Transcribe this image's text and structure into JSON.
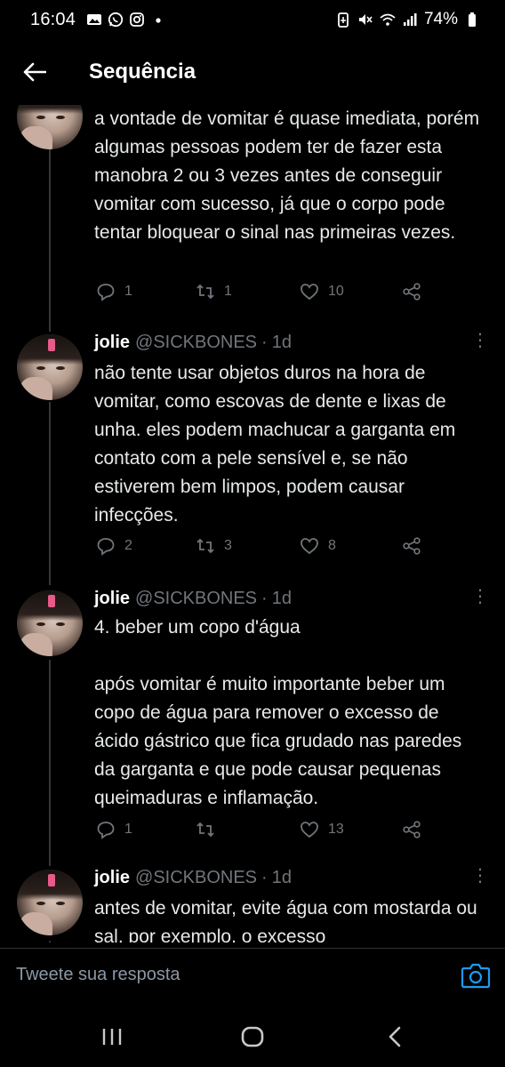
{
  "status_bar": {
    "time": "16:04",
    "battery": "74%",
    "left_icons": [
      "gallery-icon",
      "whatsapp-icon",
      "instagram-icon",
      "dot-icon"
    ],
    "right_icons": [
      "battery-saver-icon",
      "mute-icon",
      "wifi-icon",
      "signal-icon",
      "battery-icon"
    ]
  },
  "header": {
    "title": "Sequência",
    "back_icon": "back-arrow-icon"
  },
  "tweets": [
    {
      "text": "a vontade de vomitar é quase imediata, porém algumas pessoas podem ter de fazer esta manobra 2 ou 3 vezes antes de conseguir vomitar com sucesso, já que o corpo pode tentar bloquear o sinal nas primeiras vezes.",
      "replies": "1",
      "retweets": "1",
      "likes": "10"
    },
    {
      "name": "jolie",
      "handle": "@SICKBONES",
      "dot": "·",
      "time": "1d",
      "text": "não tente usar objetos duros na hora de vomitar, como escovas de dente e lixas de unha. eles podem machucar a garganta em contato com a pele sensível e, se não estiverem bem limpos, podem causar infecções.",
      "replies": "2",
      "retweets": "3",
      "likes": "8"
    },
    {
      "name": "jolie",
      "handle": "@SICKBONES",
      "dot": "·",
      "time": "1d",
      "text_line1": "4. beber um copo d'água",
      "text_body": "após vomitar é muito importante beber um copo de água para remover o excesso de ácido gástrico que fica grudado nas paredes da garganta e que pode causar pequenas queimaduras e inflamação.",
      "replies": "1",
      "retweets": "",
      "likes": "13"
    },
    {
      "name": "jolie",
      "handle": "@SICKBONES",
      "dot": "·",
      "time": "1d",
      "text": "antes de vomitar, evite água com mostarda ou sal, por exemplo, o excesso"
    }
  ],
  "reply_bar": {
    "placeholder": "Tweete sua resposta",
    "camera_icon": "camera-icon"
  },
  "nav_bar": {
    "icons": [
      "recent-apps-icon",
      "home-icon",
      "back-icon"
    ]
  },
  "colors": {
    "background": "#000000",
    "text": "#e7e9ea",
    "muted": "#71767b",
    "accent": "#1d9bf0"
  }
}
